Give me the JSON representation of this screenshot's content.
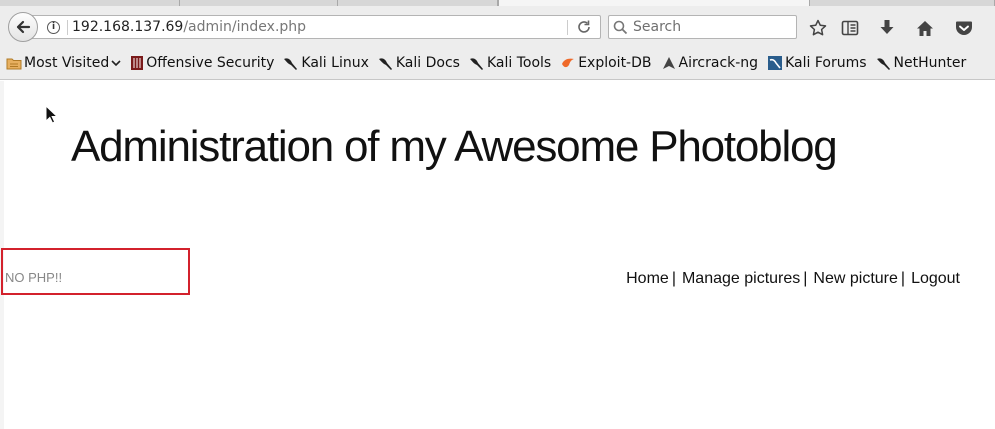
{
  "browser": {
    "url_host": "192.168.137.69",
    "url_path": "/admin/index.php",
    "search_placeholder": "Search",
    "info_glyph": "i",
    "icons": [
      "back-arrow-icon",
      "info-icon",
      "reload-icon",
      "search-icon",
      "star-icon",
      "reading-list-icon",
      "download-icon",
      "home-icon",
      "pocket-icon"
    ]
  },
  "bookmarks": [
    {
      "label": "Most Visited",
      "icon": "folder-icon"
    },
    {
      "label": "Offensive Security",
      "icon": "offsec-icon"
    },
    {
      "label": "Kali Linux",
      "icon": "kali-dragon-icon"
    },
    {
      "label": "Kali Docs",
      "icon": "kali-dragon-icon"
    },
    {
      "label": "Kali Tools",
      "icon": "kali-dragon-icon"
    },
    {
      "label": "Exploit-DB",
      "icon": "exploit-db-icon"
    },
    {
      "label": "Aircrack-ng",
      "icon": "aircrack-icon"
    },
    {
      "label": "Kali Forums",
      "icon": "kali-forums-icon"
    },
    {
      "label": "NetHunter",
      "icon": "kali-dragon-icon"
    }
  ],
  "page": {
    "title": "Administration of my Awesome Photoblog",
    "message": "NO PHP!!",
    "highlight_color": "#d3212c",
    "menu": [
      {
        "label": "Home"
      },
      {
        "label": "Manage pictures"
      },
      {
        "label": "New picture"
      },
      {
        "label": "Logout"
      }
    ],
    "menu_separator": "|"
  }
}
